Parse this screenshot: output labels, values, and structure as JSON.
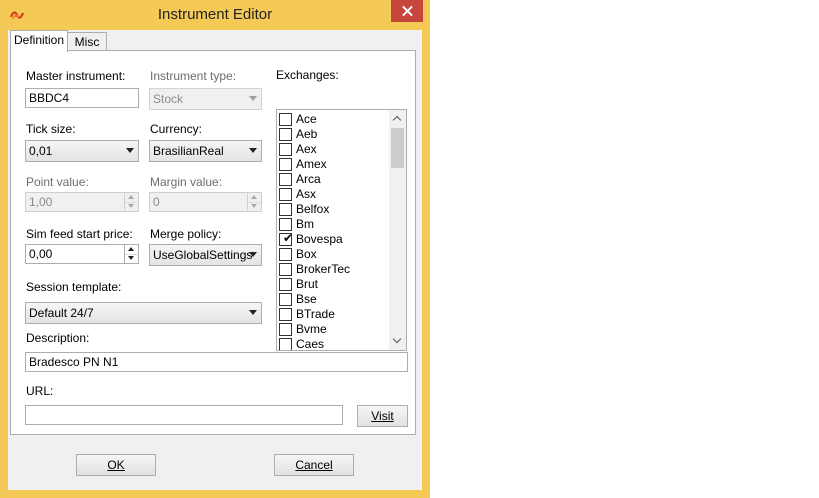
{
  "window": {
    "title": "Instrument Editor",
    "accent": "#f5c955",
    "close_color": "#c7463c"
  },
  "tabs": [
    {
      "label": "Definition",
      "active": true
    },
    {
      "label": "Misc",
      "active": false
    }
  ],
  "form": {
    "master_instrument": {
      "label": "Master instrument:",
      "value": "BBDC4"
    },
    "instrument_type": {
      "label": "Instrument type:",
      "value": "Stock",
      "enabled": false
    },
    "tick_size": {
      "label": "Tick size:",
      "value": "0,01"
    },
    "currency": {
      "label": "Currency:",
      "value": "BrasilianReal"
    },
    "point_value": {
      "label": "Point value:",
      "value": "1,00",
      "enabled": false
    },
    "margin_value": {
      "label": "Margin value:",
      "value": "0",
      "enabled": false
    },
    "sim_feed_start_price": {
      "label": "Sim feed start price:",
      "value": "0,00"
    },
    "merge_policy": {
      "label": "Merge policy:",
      "value": "UseGlobalSettings"
    },
    "session_template": {
      "label": "Session template:",
      "value": "Default 24/7"
    },
    "description": {
      "label": "Description:",
      "value": "Bradesco PN N1"
    },
    "url": {
      "label": "URL:",
      "value": ""
    },
    "visit_button": "Visit"
  },
  "exchanges": {
    "label": "Exchanges:",
    "items": [
      {
        "name": "Ace",
        "checked": false
      },
      {
        "name": "Aeb",
        "checked": false
      },
      {
        "name": "Aex",
        "checked": false
      },
      {
        "name": "Amex",
        "checked": false
      },
      {
        "name": "Arca",
        "checked": false
      },
      {
        "name": "Asx",
        "checked": false
      },
      {
        "name": "Belfox",
        "checked": false
      },
      {
        "name": "Bm",
        "checked": false
      },
      {
        "name": "Bovespa",
        "checked": true
      },
      {
        "name": "Box",
        "checked": false
      },
      {
        "name": "BrokerTec",
        "checked": false
      },
      {
        "name": "Brut",
        "checked": false
      },
      {
        "name": "Bse",
        "checked": false
      },
      {
        "name": "BTrade",
        "checked": false
      },
      {
        "name": "Bvme",
        "checked": false
      },
      {
        "name": "Caes",
        "checked": false
      }
    ]
  },
  "footer": {
    "ok": "OK",
    "cancel": "Cancel"
  }
}
